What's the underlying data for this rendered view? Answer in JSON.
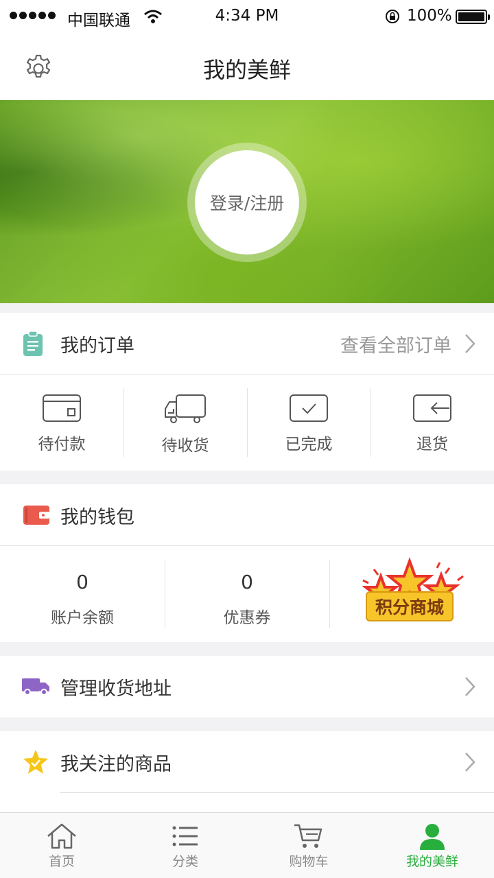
{
  "status_bar": {
    "carrier": "中国联通",
    "time": "4:34 PM",
    "battery": "100%"
  },
  "header": {
    "title": "我的美鲜"
  },
  "profile": {
    "login_label": "登录/注册"
  },
  "orders": {
    "title": "我的订单",
    "view_all": "查看全部订单",
    "items": [
      {
        "label": "待付款",
        "icon": "card-icon"
      },
      {
        "label": "待收货",
        "icon": "truck-icon"
      },
      {
        "label": "已完成",
        "icon": "check-box-icon"
      },
      {
        "label": "退货",
        "icon": "return-icon"
      }
    ]
  },
  "wallet": {
    "title": "我的钱包",
    "balance_value": "0",
    "balance_label": "账户余额",
    "coupon_value": "0",
    "coupon_label": "优惠券",
    "mall_label": "积分商城"
  },
  "address": {
    "label": "管理收货地址"
  },
  "favorites": {
    "label": "我关注的商品"
  },
  "tabbar": {
    "items": [
      {
        "label": "首页",
        "icon": "home-icon"
      },
      {
        "label": "分类",
        "icon": "list-icon"
      },
      {
        "label": "购物车",
        "icon": "cart-icon"
      },
      {
        "label": "我的美鲜",
        "icon": "user-icon",
        "active": true
      }
    ]
  },
  "colors": {
    "accent": "#27ae3d",
    "hero_green": "#7cb82f"
  }
}
